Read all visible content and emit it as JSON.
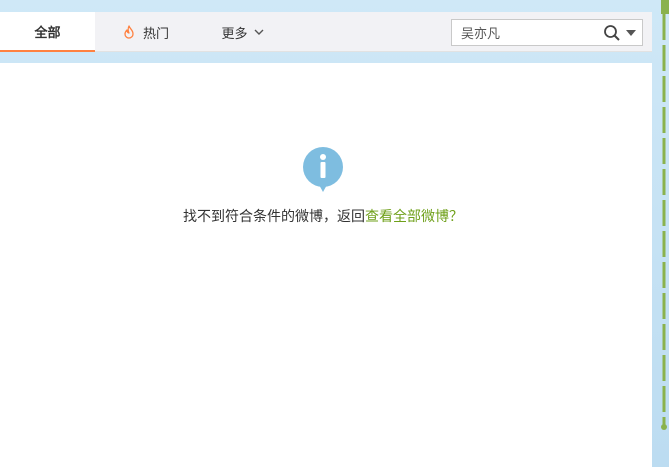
{
  "tabs": {
    "all": "全部",
    "hot": "热门",
    "more": "更多"
  },
  "search": {
    "value": "吴亦凡",
    "placeholder": "吴亦凡"
  },
  "empty_state": {
    "message": "找不到符合条件的微博，返回",
    "link": "查看全部微博？"
  },
  "colors": {
    "accent_orange": "#ff8140",
    "link_green": "#6fa01a",
    "info_blue": "#7ebde0",
    "rail_green": "#8ab24d"
  },
  "icons": [
    "fire-icon",
    "chevron-down-icon",
    "search-icon",
    "dropdown-arrow-icon",
    "info-icon"
  ]
}
